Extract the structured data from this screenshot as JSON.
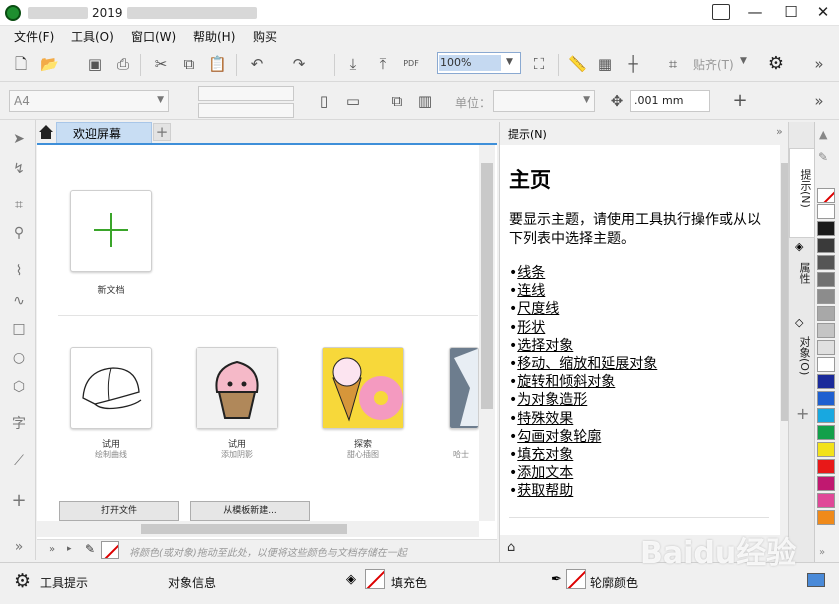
{
  "titlebar": {
    "title": "2019"
  },
  "menu": [
    "文件(F)",
    "工具(O)",
    "窗口(W)",
    "帮助(H)",
    "购买"
  ],
  "toolbar": {
    "zoom": "100%",
    "snap_label": "贴齐(T)"
  },
  "propertybar": {
    "paper_size": "A4",
    "unit_label": "单位：",
    "nudge": ".001 mm"
  },
  "tabs": {
    "welcome": "欢迎屏幕"
  },
  "welcome": {
    "new_doc": "新文档",
    "items": [
      {
        "title": "试用",
        "subtitle": "绘制曲线"
      },
      {
        "title": "试用",
        "subtitle": "添加阴影"
      },
      {
        "title": "探索",
        "subtitle": "甜心插图"
      },
      {
        "title": "",
        "subtitle": "哈士"
      }
    ],
    "open_file": "打开文件",
    "from_template": "从模板新建..."
  },
  "colorbar": {
    "hint": "将颜色(或对象)拖动至此处，以便将这些颜色与文档存储在一起"
  },
  "hints": {
    "panel_title": "提示(N)",
    "heading": "主页",
    "intro": "要显示主题，请使用工具执行操作或从以下列表中选择主题。",
    "links": [
      "线条",
      "连线",
      "尺度线",
      "形状",
      "选择对象",
      "移动、缩放和延展对象",
      "旋转和倾斜对象",
      "为对象造形",
      "特殊效果",
      "勾画对象轮廓",
      "填充对象",
      "添加文本",
      "获取帮助"
    ]
  },
  "sidetabs": [
    "提示(N)",
    "属性",
    "对象(O)"
  ],
  "palette": [
    "#ffffff",
    "#1a1a1a",
    "#3a3a3a",
    "#555555",
    "#707070",
    "#8c8c8c",
    "#a8a8a8",
    "#c4c4c4",
    "#e0e0e0",
    "#ffffff",
    "#1a2a9a",
    "#1e5fd0",
    "#18a8e0",
    "#12a04a",
    "#f2e21a",
    "#e81818",
    "#c01870",
    "#e04898",
    "#f08a1a"
  ],
  "statusbar": {
    "tool_hints": "工具提示",
    "object_info": "对象信息",
    "fill_label": "填充色",
    "outline_label": "轮廓颜色"
  },
  "watermark": "Baidu经验"
}
